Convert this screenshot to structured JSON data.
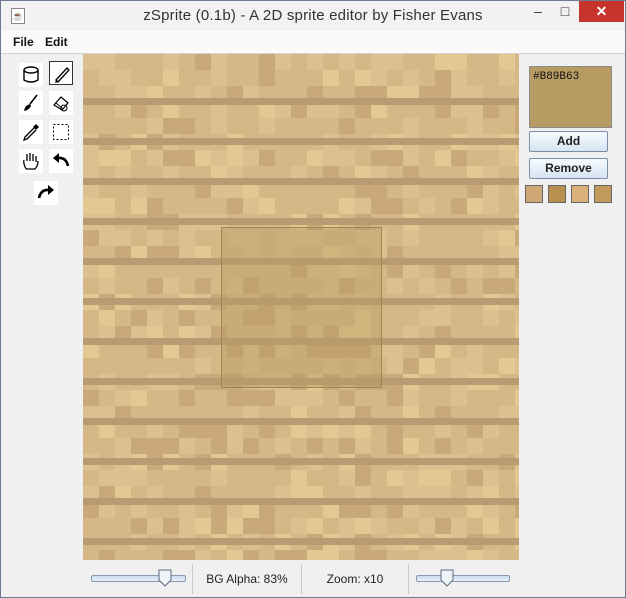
{
  "window": {
    "title": "zSprite (0.1b) - A 2D sprite editor by Fisher Evans",
    "minimize_glyph": "–",
    "maximize_glyph": "□",
    "close_glyph": "✕"
  },
  "menu": {
    "items": [
      {
        "label": "File"
      },
      {
        "label": "Edit"
      }
    ]
  },
  "toolbox": {
    "tools": [
      {
        "name": "fill-bucket-icon",
        "selected": false
      },
      {
        "name": "pencil-icon",
        "selected": true
      },
      {
        "name": "brush-icon",
        "selected": false
      },
      {
        "name": "eraser-icon",
        "selected": false
      },
      {
        "name": "eyedropper-icon",
        "selected": false
      },
      {
        "name": "selection-icon",
        "selected": false
      },
      {
        "name": "pan-hand-icon",
        "selected": false
      },
      {
        "name": "undo-icon",
        "selected": false
      },
      {
        "name": "redo-icon",
        "selected": false
      }
    ]
  },
  "canvas": {
    "base_color": "#d6b886",
    "plank_colors": [
      "#d6b886",
      "#dcc08f",
      "#c9a879",
      "#b89b70",
      "#e4c891"
    ],
    "selection_fill": "#b89b63",
    "selection_opacity": 0.45
  },
  "color_panel": {
    "current_hex": "#B89B63",
    "current_color": "#B89B63",
    "add_label": "Add",
    "remove_label": "Remove",
    "swatches": [
      "#cda775",
      "#b8904f",
      "#d9b07a",
      "#c19a5e"
    ]
  },
  "statusbar": {
    "bg_alpha_label": "BG Alpha: 83%",
    "bg_alpha_value": 0.83,
    "zoom_label": "Zoom: x10",
    "zoom_value": 0.3
  }
}
